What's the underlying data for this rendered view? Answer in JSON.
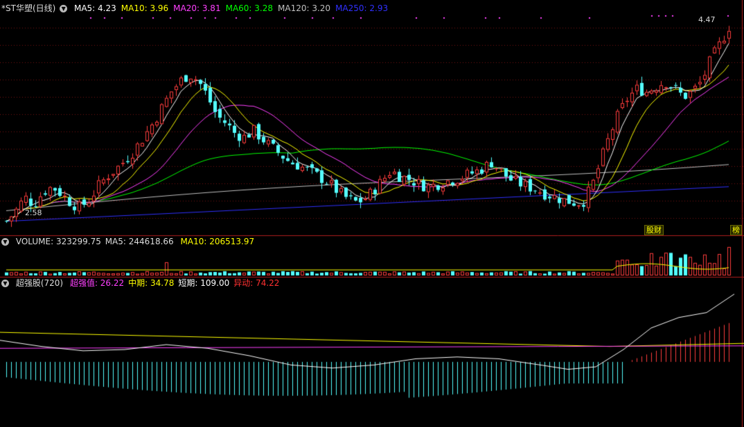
{
  "main": {
    "title": "*ST华塑(日线)",
    "legend": [
      {
        "label": "MA5:",
        "value": "4.23",
        "color": "#ffffff"
      },
      {
        "label": "MA10:",
        "value": "3.96",
        "color": "#ffff00"
      },
      {
        "label": "MA20:",
        "value": "3.81",
        "color": "#ff40ff"
      },
      {
        "label": "MA60:",
        "value": "3.28",
        "color": "#00ff00"
      },
      {
        "label": "MA120:",
        "value": "3.20",
        "color": "#c0c0c0"
      },
      {
        "label": "MA250:",
        "value": "2.93",
        "color": "#3030ff"
      }
    ],
    "high_label": "4.47",
    "low_label": "2.58",
    "tag_left": "股财",
    "tag_right": "榜"
  },
  "volume": {
    "title": "VOLUME:",
    "value": "323299.75",
    "ma5_label": "MA5:",
    "ma5": "244618.66",
    "ma10_label": "MA10:",
    "ma10": "206513.97"
  },
  "indicator": {
    "title": "超强股(720)",
    "items": [
      {
        "label": "超强值:",
        "value": "26.22",
        "color": "#ff40ff"
      },
      {
        "label": "中期:",
        "value": "34.78",
        "color": "#ffff00"
      },
      {
        "label": "短期:",
        "value": "109.00",
        "color": "#ffffff"
      },
      {
        "label": "异动:",
        "value": "74.22",
        "color": "#ff3030"
      }
    ]
  },
  "colors": {
    "up": "#ff3c3c",
    "down": "#54ffff",
    "grid": "#7a1010",
    "border": "#b01c1c",
    "ma5": "#ffffff",
    "ma10": "#ffff00",
    "ma20": "#ff40ff",
    "ma60": "#00ff00",
    "ma120": "#c0c0c0",
    "ma250": "#3030ff"
  },
  "chart_data": {
    "type": "candlestick",
    "y_range": [
      2.5,
      4.6
    ],
    "close_path": [
      2.62,
      2.72,
      2.85,
      2.78,
      2.9,
      2.95,
      2.88,
      2.8,
      2.75,
      2.82,
      2.95,
      3.05,
      3.12,
      3.2,
      3.3,
      3.42,
      3.55,
      3.7,
      3.85,
      3.95,
      4.02,
      3.95,
      3.8,
      3.62,
      3.55,
      3.45,
      3.42,
      3.48,
      3.4,
      3.32,
      3.25,
      3.18,
      3.15,
      3.1,
      3.05,
      3.0,
      2.92,
      2.85,
      2.8,
      2.82,
      2.9,
      3.0,
      3.1,
      3.05,
      3.02,
      2.98,
      2.95,
      2.97,
      3.0,
      3.02,
      3.05,
      3.08,
      3.12,
      3.18,
      3.1,
      3.02,
      2.98,
      2.95,
      2.92,
      2.88,
      2.85,
      2.82,
      2.8,
      2.8,
      2.95,
      3.2,
      3.45,
      3.65,
      3.8,
      3.88,
      3.85,
      3.9,
      3.95,
      3.88,
      3.8,
      3.85,
      3.95,
      4.15,
      4.3,
      4.47
    ],
    "volume_max": 330000,
    "indicator_range": [
      -100,
      120
    ]
  }
}
